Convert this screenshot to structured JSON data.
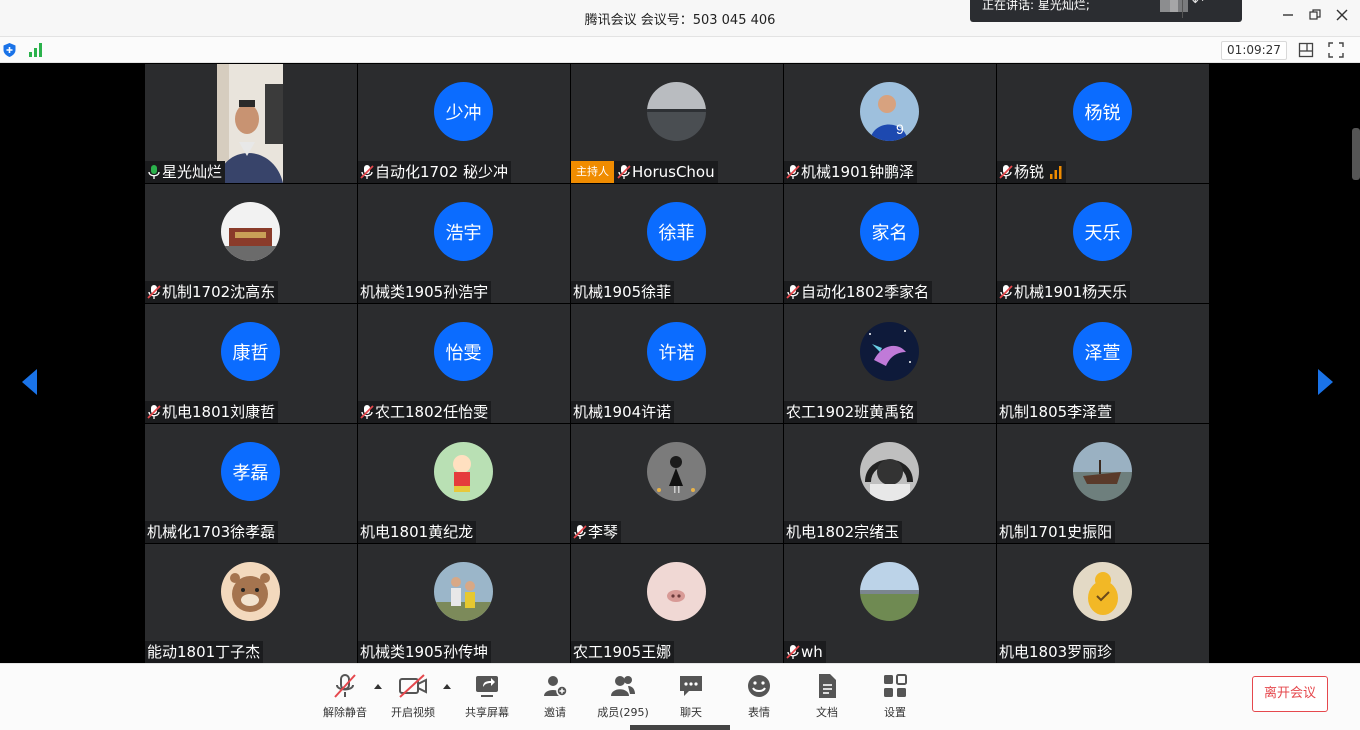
{
  "window": {
    "title": "腾讯会议 会议号：503 045 406",
    "speaking_banner": "正在讲话: 星光灿烂;",
    "timer": "01:09:27"
  },
  "colors": {
    "avatar_blue": "#0b6cff",
    "tile_bg": "#2b2c2e",
    "host_badge": "#f08c00",
    "leave_red": "#e5484d",
    "nav_arrow": "#1a73e8"
  },
  "participants": [
    {
      "name": "星光灿烂",
      "mic": "active",
      "avatar": {
        "type": "video"
      }
    },
    {
      "name": "自动化1702 秘少冲",
      "mic": "muted",
      "avatar": {
        "type": "initials",
        "text": "少冲"
      }
    },
    {
      "name": "HorusChou",
      "mic": "muted",
      "host": true,
      "host_label": "主持人",
      "avatar": {
        "type": "photo",
        "icon": "lake-photo"
      }
    },
    {
      "name": "机械1901钟鹏泽",
      "mic": "muted",
      "avatar": {
        "type": "photo",
        "icon": "football-player-photo"
      }
    },
    {
      "name": "杨锐",
      "mic": "muted",
      "signal": "weak",
      "avatar": {
        "type": "initials",
        "text": "杨锐"
      }
    },
    {
      "name": "机制1702沈高东",
      "mic": "muted",
      "avatar": {
        "type": "photo",
        "icon": "building-photo"
      }
    },
    {
      "name": "机械类1905孙浩宇",
      "mic": "none",
      "avatar": {
        "type": "initials",
        "text": "浩宇"
      }
    },
    {
      "name": "机械1905徐菲",
      "mic": "none",
      "avatar": {
        "type": "initials",
        "text": "徐菲"
      }
    },
    {
      "name": "自动化1802季家名",
      "mic": "muted",
      "avatar": {
        "type": "initials",
        "text": "家名"
      }
    },
    {
      "name": "机械1901杨天乐",
      "mic": "muted",
      "avatar": {
        "type": "initials",
        "text": "天乐"
      }
    },
    {
      "name": "机电1801刘康哲",
      "mic": "muted",
      "avatar": {
        "type": "initials",
        "text": "康哲"
      }
    },
    {
      "name": "农工1802任怡雯",
      "mic": "muted",
      "avatar": {
        "type": "initials",
        "text": "怡雯"
      }
    },
    {
      "name": "机械1904许诺",
      "mic": "none",
      "avatar": {
        "type": "initials",
        "text": "许诺"
      }
    },
    {
      "name": "农工1902班黄禹铭",
      "mic": "none",
      "avatar": {
        "type": "photo",
        "icon": "dragon-art-photo"
      }
    },
    {
      "name": "机制1805李泽萱",
      "mic": "none",
      "avatar": {
        "type": "initials",
        "text": "泽萱"
      }
    },
    {
      "name": "机械化1703徐孝磊",
      "mic": "none",
      "avatar": {
        "type": "initials",
        "text": "孝磊"
      }
    },
    {
      "name": "机电1801黄纪龙",
      "mic": "none",
      "avatar": {
        "type": "photo",
        "icon": "cartoon-photo"
      }
    },
    {
      "name": "李琴",
      "mic": "muted",
      "avatar": {
        "type": "photo",
        "icon": "girl-figure-photo"
      }
    },
    {
      "name": "机电1802宗绪玉",
      "mic": "none",
      "avatar": {
        "type": "photo",
        "icon": "headphones-photo"
      }
    },
    {
      "name": "机制1701史振阳",
      "mic": "none",
      "avatar": {
        "type": "photo",
        "icon": "shipwreck-photo"
      }
    },
    {
      "name": "能动1801丁子杰",
      "mic": "none",
      "avatar": {
        "type": "photo",
        "icon": "bear-cartoon-photo"
      }
    },
    {
      "name": "机械类1905孙传坤",
      "mic": "none",
      "avatar": {
        "type": "photo",
        "icon": "family-photo"
      }
    },
    {
      "name": "农工1905王娜",
      "mic": "none",
      "avatar": {
        "type": "photo",
        "icon": "cat-nose-photo"
      }
    },
    {
      "name": "wh",
      "mic": "muted",
      "avatar": {
        "type": "photo",
        "icon": "field-landscape-photo"
      }
    },
    {
      "name": "机电1803罗丽珍",
      "mic": "none",
      "avatar": {
        "type": "photo",
        "icon": "pear-doodle-photo"
      }
    }
  ],
  "toolbar": {
    "unmute": "解除静音",
    "start_video": "开启视频",
    "share_screen": "共享屏幕",
    "invite": "邀请",
    "members": "成员(295)",
    "chat": "聊天",
    "reactions": "表情",
    "docs": "文档",
    "settings": "设置",
    "leave": "离开会议"
  }
}
